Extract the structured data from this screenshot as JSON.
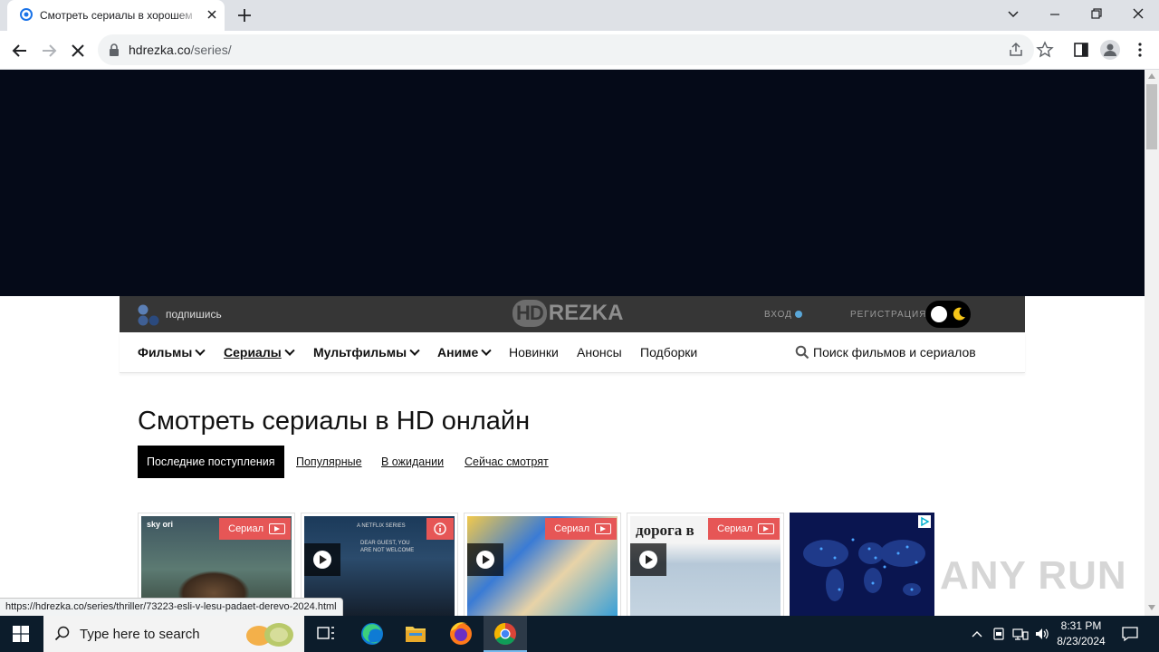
{
  "browser": {
    "tab_title": "Смотреть сериалы в хорошем",
    "url_host": "hdrezka.co",
    "url_path": "/series/",
    "status_url": "https://hdrezka.co/series/thriller/73223-esli-v-lesu-padaet-derevo-2024.html"
  },
  "site": {
    "subscribe_label": "подпишись",
    "logo_hd": "HD",
    "logo_rezka": "REZKA",
    "login_label": "ВХОД",
    "register_label": "РЕГИСТРАЦИЯ",
    "nav": [
      {
        "label": "Фильмы",
        "dropdown": true,
        "bold": true,
        "active": false
      },
      {
        "label": "Сериалы",
        "dropdown": true,
        "bold": true,
        "active": true
      },
      {
        "label": "Мультфильмы",
        "dropdown": true,
        "bold": true,
        "active": false
      },
      {
        "label": "Аниме",
        "dropdown": true,
        "bold": true,
        "active": false
      },
      {
        "label": "Новинки",
        "dropdown": false,
        "bold": false,
        "active": false
      },
      {
        "label": "Анонсы",
        "dropdown": false,
        "bold": false,
        "active": false
      },
      {
        "label": "Подборки",
        "dropdown": false,
        "bold": false,
        "active": false
      }
    ],
    "search_placeholder": "Поиск фильмов и сериалов",
    "heading": "Смотреть сериалы в HD онлайн",
    "filters": [
      "Последние поступления",
      "Популярные",
      "В ожидании",
      "Сейчас смотрят"
    ],
    "cards": [
      {
        "badge": "Сериал",
        "poster_text": "sky ori"
      },
      {
        "badge": "",
        "poster_text": "A NETFLIX SERIES",
        "poster_sub": "DEAR GUEST, YOU ARE NOT WELCOME"
      },
      {
        "badge": "Сериал",
        "poster_text": ""
      },
      {
        "badge": "Сериал",
        "poster_text": "дорога в"
      }
    ]
  },
  "taskbar": {
    "search_placeholder": "Type here to search",
    "time": "8:31 PM",
    "date": "8/23/2024"
  },
  "watermark": "ANY RUN",
  "colors": {
    "accent_red": "#e65656",
    "topbar": "#363636",
    "ad_bg": "#050a18",
    "login_dot": "#5aa7d9"
  }
}
